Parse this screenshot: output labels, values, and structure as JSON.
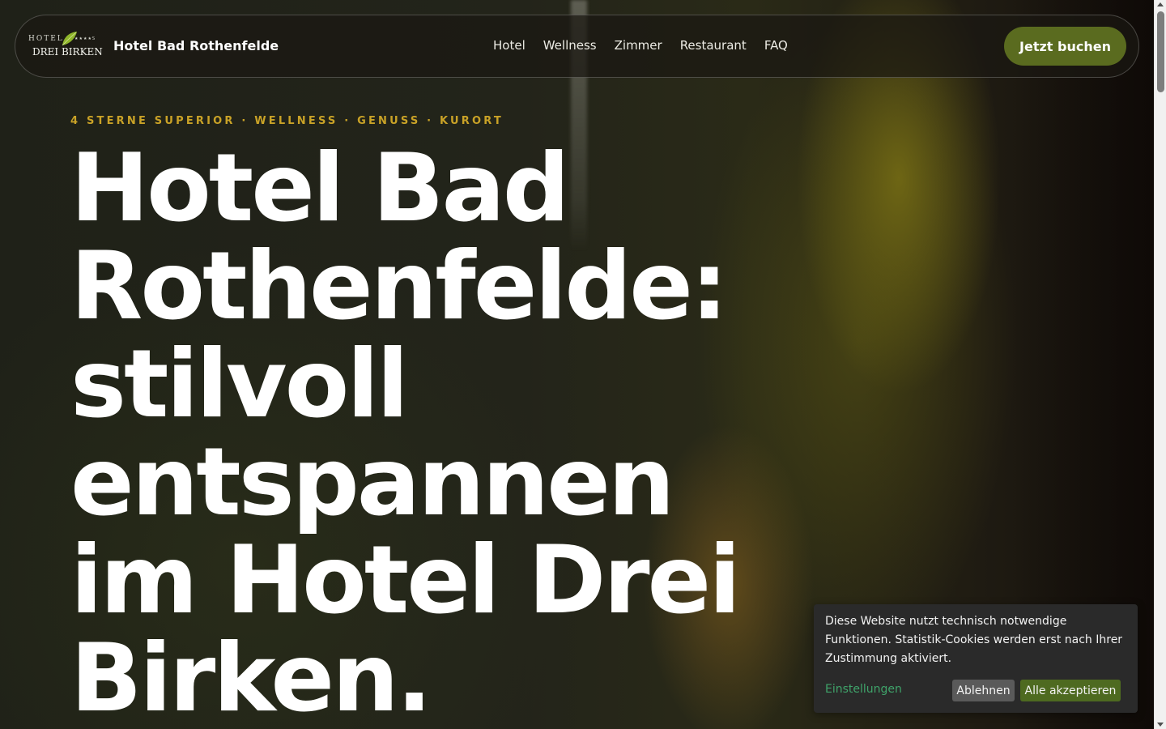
{
  "header": {
    "logo": {
      "line1": "HOTEL",
      "line2": "DREI BIRKEN",
      "stars": "★★★★S"
    },
    "brand_name": "Hotel Bad Rothenfelde",
    "nav": [
      {
        "label": "Hotel"
      },
      {
        "label": "Wellness"
      },
      {
        "label": "Zimmer"
      },
      {
        "label": "Restaurant"
      },
      {
        "label": "FAQ"
      }
    ],
    "cta_label": "Jetzt buchen"
  },
  "hero": {
    "eyebrow": "4 STERNE SUPERIOR · WELLNESS · GENUSS · KURORT",
    "headline_lines": [
      "Hotel Bad",
      "Rothenfelde:",
      "stilvoll",
      "entspannen",
      "im Hotel Drei",
      "Birken."
    ]
  },
  "cookie_banner": {
    "message": "Diese Website nutzt technisch notwendige Funktionen. Statistik-Cookies werden erst nach Ihrer Zustimmung aktiviert.",
    "settings_label": "Einstellungen",
    "decline_label": "Ablehnen",
    "accept_label": "Alle akzeptieren"
  },
  "colors": {
    "accent_gold": "#c9a227",
    "cta_green": "#5a6b1f",
    "accept_green": "#4e6a20",
    "link_green": "#3fa36a"
  }
}
